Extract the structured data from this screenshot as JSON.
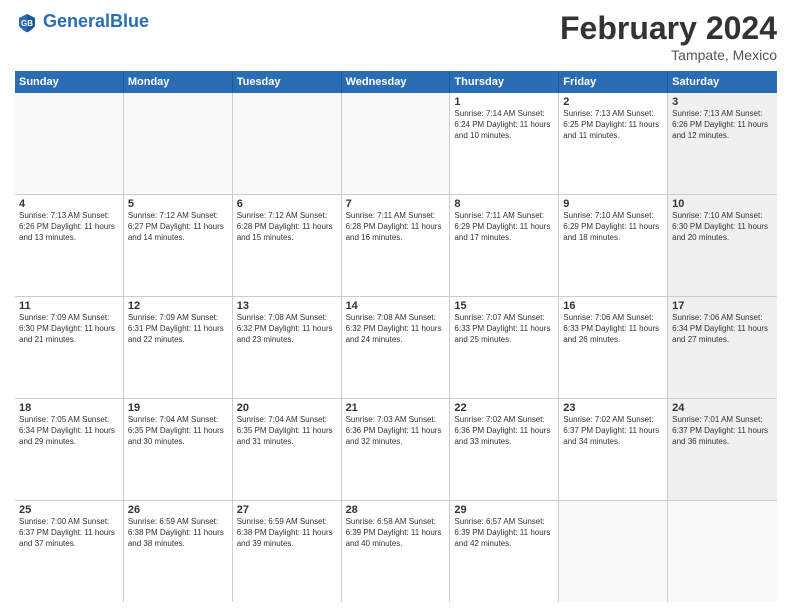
{
  "header": {
    "logo_general": "General",
    "logo_blue": "Blue",
    "title": "February 2024",
    "subtitle": "Tampate, Mexico"
  },
  "days_of_week": [
    "Sunday",
    "Monday",
    "Tuesday",
    "Wednesday",
    "Thursday",
    "Friday",
    "Saturday"
  ],
  "weeks": [
    [
      {
        "day": "",
        "info": "",
        "shaded": false,
        "empty": true
      },
      {
        "day": "",
        "info": "",
        "shaded": false,
        "empty": true
      },
      {
        "day": "",
        "info": "",
        "shaded": false,
        "empty": true
      },
      {
        "day": "",
        "info": "",
        "shaded": false,
        "empty": true
      },
      {
        "day": "1",
        "info": "Sunrise: 7:14 AM\nSunset: 6:24 PM\nDaylight: 11 hours\nand 10 minutes.",
        "shaded": false,
        "empty": false
      },
      {
        "day": "2",
        "info": "Sunrise: 7:13 AM\nSunset: 6:25 PM\nDaylight: 11 hours\nand 11 minutes.",
        "shaded": false,
        "empty": false
      },
      {
        "day": "3",
        "info": "Sunrise: 7:13 AM\nSunset: 6:26 PM\nDaylight: 11 hours\nand 12 minutes.",
        "shaded": true,
        "empty": false
      }
    ],
    [
      {
        "day": "4",
        "info": "Sunrise: 7:13 AM\nSunset: 6:26 PM\nDaylight: 11 hours\nand 13 minutes.",
        "shaded": false,
        "empty": false
      },
      {
        "day": "5",
        "info": "Sunrise: 7:12 AM\nSunset: 6:27 PM\nDaylight: 11 hours\nand 14 minutes.",
        "shaded": false,
        "empty": false
      },
      {
        "day": "6",
        "info": "Sunrise: 7:12 AM\nSunset: 6:28 PM\nDaylight: 11 hours\nand 15 minutes.",
        "shaded": false,
        "empty": false
      },
      {
        "day": "7",
        "info": "Sunrise: 7:11 AM\nSunset: 6:28 PM\nDaylight: 11 hours\nand 16 minutes.",
        "shaded": false,
        "empty": false
      },
      {
        "day": "8",
        "info": "Sunrise: 7:11 AM\nSunset: 6:29 PM\nDaylight: 11 hours\nand 17 minutes.",
        "shaded": false,
        "empty": false
      },
      {
        "day": "9",
        "info": "Sunrise: 7:10 AM\nSunset: 6:29 PM\nDaylight: 11 hours\nand 18 minutes.",
        "shaded": false,
        "empty": false
      },
      {
        "day": "10",
        "info": "Sunrise: 7:10 AM\nSunset: 6:30 PM\nDaylight: 11 hours\nand 20 minutes.",
        "shaded": true,
        "empty": false
      }
    ],
    [
      {
        "day": "11",
        "info": "Sunrise: 7:09 AM\nSunset: 6:30 PM\nDaylight: 11 hours\nand 21 minutes.",
        "shaded": false,
        "empty": false
      },
      {
        "day": "12",
        "info": "Sunrise: 7:09 AM\nSunset: 6:31 PM\nDaylight: 11 hours\nand 22 minutes.",
        "shaded": false,
        "empty": false
      },
      {
        "day": "13",
        "info": "Sunrise: 7:08 AM\nSunset: 6:32 PM\nDaylight: 11 hours\nand 23 minutes.",
        "shaded": false,
        "empty": false
      },
      {
        "day": "14",
        "info": "Sunrise: 7:08 AM\nSunset: 6:32 PM\nDaylight: 11 hours\nand 24 minutes.",
        "shaded": false,
        "empty": false
      },
      {
        "day": "15",
        "info": "Sunrise: 7:07 AM\nSunset: 6:33 PM\nDaylight: 11 hours\nand 25 minutes.",
        "shaded": false,
        "empty": false
      },
      {
        "day": "16",
        "info": "Sunrise: 7:06 AM\nSunset: 6:33 PM\nDaylight: 11 hours\nand 26 minutes.",
        "shaded": false,
        "empty": false
      },
      {
        "day": "17",
        "info": "Sunrise: 7:06 AM\nSunset: 6:34 PM\nDaylight: 11 hours\nand 27 minutes.",
        "shaded": true,
        "empty": false
      }
    ],
    [
      {
        "day": "18",
        "info": "Sunrise: 7:05 AM\nSunset: 6:34 PM\nDaylight: 11 hours\nand 29 minutes.",
        "shaded": false,
        "empty": false
      },
      {
        "day": "19",
        "info": "Sunrise: 7:04 AM\nSunset: 6:35 PM\nDaylight: 11 hours\nand 30 minutes.",
        "shaded": false,
        "empty": false
      },
      {
        "day": "20",
        "info": "Sunrise: 7:04 AM\nSunset: 6:35 PM\nDaylight: 11 hours\nand 31 minutes.",
        "shaded": false,
        "empty": false
      },
      {
        "day": "21",
        "info": "Sunrise: 7:03 AM\nSunset: 6:36 PM\nDaylight: 11 hours\nand 32 minutes.",
        "shaded": false,
        "empty": false
      },
      {
        "day": "22",
        "info": "Sunrise: 7:02 AM\nSunset: 6:36 PM\nDaylight: 11 hours\nand 33 minutes.",
        "shaded": false,
        "empty": false
      },
      {
        "day": "23",
        "info": "Sunrise: 7:02 AM\nSunset: 6:37 PM\nDaylight: 11 hours\nand 34 minutes.",
        "shaded": false,
        "empty": false
      },
      {
        "day": "24",
        "info": "Sunrise: 7:01 AM\nSunset: 6:37 PM\nDaylight: 11 hours\nand 36 minutes.",
        "shaded": true,
        "empty": false
      }
    ],
    [
      {
        "day": "25",
        "info": "Sunrise: 7:00 AM\nSunset: 6:37 PM\nDaylight: 11 hours\nand 37 minutes.",
        "shaded": false,
        "empty": false
      },
      {
        "day": "26",
        "info": "Sunrise: 6:59 AM\nSunset: 6:38 PM\nDaylight: 11 hours\nand 38 minutes.",
        "shaded": false,
        "empty": false
      },
      {
        "day": "27",
        "info": "Sunrise: 6:59 AM\nSunset: 6:38 PM\nDaylight: 11 hours\nand 39 minutes.",
        "shaded": false,
        "empty": false
      },
      {
        "day": "28",
        "info": "Sunrise: 6:58 AM\nSunset: 6:39 PM\nDaylight: 11 hours\nand 40 minutes.",
        "shaded": false,
        "empty": false
      },
      {
        "day": "29",
        "info": "Sunrise: 6:57 AM\nSunset: 6:39 PM\nDaylight: 11 hours\nand 42 minutes.",
        "shaded": false,
        "empty": false
      },
      {
        "day": "",
        "info": "",
        "shaded": false,
        "empty": true
      },
      {
        "day": "",
        "info": "",
        "shaded": true,
        "empty": true
      }
    ]
  ]
}
